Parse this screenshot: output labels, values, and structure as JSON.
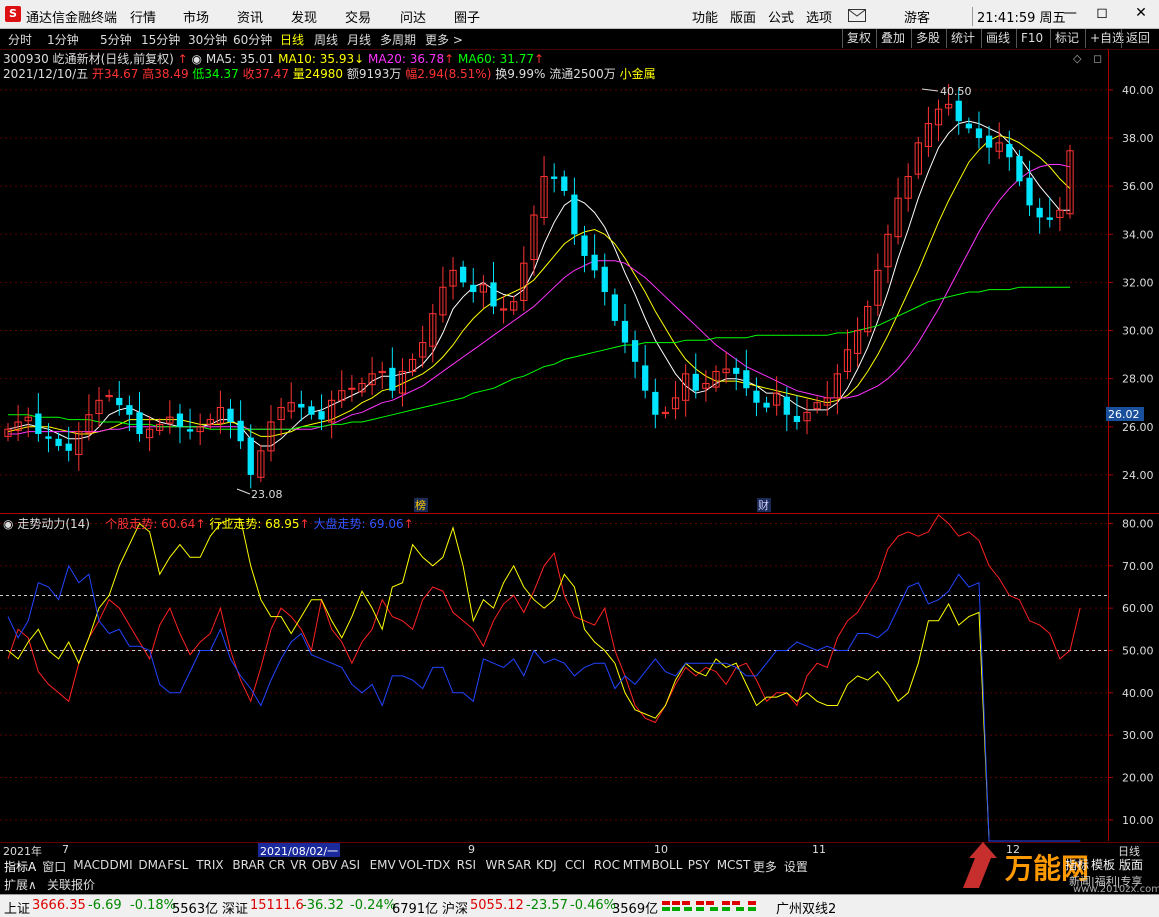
{
  "titlebar": {
    "logo_text": "S",
    "app_name": "通达信金融终端",
    "menus": [
      "行情",
      "市场",
      "资讯",
      "发现",
      "交易",
      "问达",
      "圈子"
    ],
    "right_menus": [
      "功能",
      "版面",
      "公式",
      "选项"
    ],
    "user": "游客",
    "clock": "21:41:59 周五",
    "email_icon": "envelope-icon"
  },
  "period_tabs": [
    "分时",
    "1分钟",
    "5分钟",
    "15分钟",
    "30分钟",
    "60分钟",
    "日线",
    "周线",
    "月线",
    "多周期",
    "更多 >"
  ],
  "active_period": "日线",
  "right_buttons": [
    "复权",
    "叠加",
    "多股",
    "统计",
    "画线",
    "F10",
    "标记",
    "+自选",
    "返回"
  ],
  "stock": {
    "title": "300930 屹通新材(日线,前复权)",
    "ma5": "MA5: 35.01",
    "ma10": "MA10: 35.93",
    "ma20": "MA20: 36.78",
    "ma60": "MA60: 31.77",
    "date": "2021/12/10/五",
    "open": "开34.67",
    "high": "高38.49",
    "low": "低34.37",
    "close": "收37.47",
    "volume": "量24980",
    "amount": "额9193万",
    "change": "幅2.94(8.51%)",
    "turnover": "换9.99%",
    "float": "流通2500万",
    "sector": "小金属",
    "max_label": "40.50",
    "min_label": "23.08",
    "current_price_tag": "26.02",
    "marker_bang": "榜",
    "marker_cai": "财",
    "colors": {
      "up": "#ff3333",
      "down": "#00e5ff",
      "ma5": "#ffffff",
      "ma10": "#ffff00",
      "ma20": "#ff33ff",
      "ma60": "#00ff00"
    }
  },
  "indicator": {
    "name": "走势动力(14)",
    "stock_trend": "个股走势: 60.64",
    "industry_trend": "行业走势: 68.95",
    "market_trend": "大盘走势: 69.06"
  },
  "chart_data": [
    {
      "type": "candlestick",
      "title": "300930 屹通新材(日线,前复权)",
      "y_ticks": [
        "40.00",
        "38.00",
        "36.00",
        "34.00",
        "32.00",
        "30.00",
        "28.00",
        "26.00",
        "24.00"
      ],
      "ylim": [
        22.5,
        41.7
      ],
      "series": [
        {
          "name": "K线",
          "close_path": [
            25.9,
            26.2,
            26.4,
            25.7,
            25.5,
            25.2,
            25.0,
            25.8,
            26.5,
            27.1,
            27.3,
            26.9,
            26.5,
            25.7,
            25.9,
            26.1,
            26.4,
            26.0,
            25.8,
            26.0,
            26.3,
            26.8,
            26.2,
            25.4,
            24.0,
            25.0,
            26.2,
            26.8,
            27.0,
            26.8,
            26.5,
            26.3,
            27.1,
            27.5,
            27.6,
            27.8,
            28.2,
            28.3,
            27.5,
            28.3,
            28.8,
            29.5,
            30.7,
            31.8,
            32.5,
            32.0,
            31.6,
            31.9,
            31.0,
            30.9,
            31.2,
            32.8,
            34.8,
            36.4,
            36.3,
            35.8,
            34.0,
            33.1,
            32.5,
            31.6,
            30.4,
            29.5,
            28.7,
            27.5,
            26.5,
            26.6,
            27.2,
            28.2,
            27.5,
            27.8,
            28.3,
            28.4,
            28.2,
            27.6,
            27.0,
            26.8,
            27.4,
            26.5,
            26.2,
            26.6,
            27.0,
            27.2,
            28.2,
            29.2,
            30.0,
            31.0,
            32.5,
            34.0,
            35.5,
            36.4,
            37.8,
            38.6,
            39.2,
            39.4,
            38.7,
            38.4,
            38.0,
            37.6,
            37.8,
            37.2,
            36.2,
            35.2,
            34.7,
            34.6,
            35.0,
            37.47
          ]
        },
        {
          "name": "MA5",
          "values": [
            25.9,
            26.0,
            26.1,
            26.0,
            25.9,
            25.7,
            25.5,
            25.5,
            25.6,
            26.0,
            26.5,
            26.7,
            26.8,
            26.6,
            26.4,
            26.2,
            26.1,
            26.0,
            26.0,
            26.0,
            26.1,
            26.3,
            26.3,
            26.0,
            25.5,
            25.2,
            25.2,
            25.5,
            25.9,
            26.3,
            26.6,
            26.7,
            26.9,
            27.1,
            27.3,
            27.5,
            27.9,
            28.1,
            28.1,
            28.2,
            28.3,
            28.6,
            29.1,
            29.9,
            30.9,
            31.4,
            31.8,
            32.0,
            31.7,
            31.5,
            31.4,
            31.7,
            32.5,
            33.6,
            34.5,
            35.2,
            35.5,
            35.3,
            34.9,
            34.3,
            33.4,
            32.4,
            31.5,
            30.5,
            29.6,
            28.9,
            28.2,
            27.7,
            27.4,
            27.5,
            27.8,
            28.0,
            28.0,
            27.9,
            27.7,
            27.4,
            27.4,
            27.2,
            26.9,
            26.7,
            26.7,
            26.7,
            27.0,
            27.6,
            28.4,
            29.3,
            30.4,
            31.6,
            33.0,
            34.2,
            35.5,
            36.6,
            37.6,
            38.2,
            38.6,
            38.7,
            38.6,
            38.4,
            38.2,
            37.8,
            37.2,
            36.6,
            36.0,
            35.5,
            35.0,
            35.0
          ]
        },
        {
          "name": "MA10",
          "values": [
            25.8,
            25.9,
            26.0,
            26.0,
            26.0,
            25.9,
            25.8,
            25.7,
            25.7,
            25.8,
            25.9,
            26.1,
            26.3,
            26.3,
            26.3,
            26.3,
            26.3,
            26.3,
            26.2,
            26.1,
            26.1,
            26.1,
            26.2,
            26.1,
            25.8,
            25.6,
            25.6,
            25.7,
            25.8,
            26.0,
            26.1,
            26.2,
            26.3,
            26.5,
            26.7,
            27.0,
            27.2,
            27.5,
            27.6,
            27.8,
            28.0,
            28.2,
            28.5,
            28.9,
            29.4,
            30.0,
            30.5,
            30.9,
            31.2,
            31.4,
            31.6,
            31.8,
            32.1,
            32.6,
            33.1,
            33.6,
            33.9,
            34.1,
            34.2,
            34.0,
            33.6,
            33.0,
            32.3,
            31.6,
            30.8,
            30.1,
            29.4,
            28.8,
            28.4,
            28.1,
            27.9,
            27.9,
            27.9,
            27.8,
            27.7,
            27.6,
            27.5,
            27.4,
            27.3,
            27.2,
            27.1,
            27.0,
            27.1,
            27.3,
            27.7,
            28.3,
            29.0,
            29.8,
            30.7,
            31.6,
            32.5,
            33.5,
            34.5,
            35.4,
            36.2,
            37.0,
            37.5,
            37.9,
            38.1,
            38.0,
            37.8,
            37.5,
            37.2,
            36.8,
            36.3,
            35.9
          ]
        },
        {
          "name": "MA20",
          "values": [
            25.7,
            25.7,
            25.8,
            25.8,
            25.8,
            25.8,
            25.8,
            25.8,
            25.8,
            25.8,
            25.9,
            25.9,
            26.0,
            26.0,
            26.0,
            26.0,
            26.0,
            26.0,
            26.0,
            26.0,
            26.0,
            26.0,
            26.0,
            26.0,
            25.9,
            25.9,
            25.9,
            25.9,
            25.9,
            25.9,
            25.9,
            26.0,
            26.1,
            26.3,
            26.5,
            26.6,
            26.8,
            27.0,
            27.1,
            27.3,
            27.5,
            27.7,
            28.0,
            28.3,
            28.6,
            28.9,
            29.2,
            29.5,
            29.8,
            30.1,
            30.4,
            30.7,
            31.0,
            31.4,
            31.8,
            32.2,
            32.5,
            32.7,
            32.9,
            32.9,
            32.9,
            32.8,
            32.5,
            32.2,
            31.8,
            31.4,
            31.0,
            30.6,
            30.2,
            29.8,
            29.4,
            29.1,
            28.8,
            28.5,
            28.3,
            28.1,
            27.9,
            27.7,
            27.5,
            27.4,
            27.3,
            27.2,
            27.2,
            27.2,
            27.3,
            27.5,
            27.7,
            28.0,
            28.4,
            28.9,
            29.5,
            30.2,
            30.9,
            31.7,
            32.5,
            33.3,
            34.1,
            34.8,
            35.4,
            35.9,
            36.3,
            36.6,
            36.8,
            36.9,
            36.9,
            36.8
          ]
        },
        {
          "name": "MA60",
          "values": [
            26.5,
            26.5,
            26.5,
            26.4,
            26.4,
            26.4,
            26.3,
            26.3,
            26.3,
            26.2,
            26.2,
            26.2,
            26.1,
            26.1,
            26.1,
            26.0,
            26.0,
            26.0,
            26.0,
            26.0,
            25.9,
            25.9,
            25.9,
            25.9,
            25.9,
            25.9,
            25.9,
            25.9,
            25.9,
            26.0,
            26.0,
            26.0,
            26.1,
            26.1,
            26.2,
            26.2,
            26.3,
            26.4,
            26.5,
            26.6,
            26.7,
            26.8,
            26.9,
            27.0,
            27.1,
            27.2,
            27.4,
            27.5,
            27.6,
            27.8,
            28.0,
            28.1,
            28.3,
            28.5,
            28.6,
            28.8,
            28.9,
            29.0,
            29.1,
            29.2,
            29.3,
            29.4,
            29.4,
            29.5,
            29.5,
            29.5,
            29.5,
            29.6,
            29.6,
            29.6,
            29.7,
            29.7,
            29.7,
            29.7,
            29.8,
            29.8,
            29.8,
            29.8,
            29.8,
            29.8,
            29.8,
            29.8,
            29.9,
            29.9,
            30.0,
            30.1,
            30.2,
            30.4,
            30.6,
            30.8,
            31.0,
            31.2,
            31.3,
            31.4,
            31.5,
            31.6,
            31.6,
            31.7,
            31.7,
            31.7,
            31.8,
            31.8,
            31.8,
            31.8,
            31.8,
            31.8
          ]
        }
      ]
    },
    {
      "type": "line",
      "title": "走势动力(14)",
      "y_ticks": [
        "80.00",
        "70.00",
        "60.00",
        "50.00",
        "40.00",
        "30.00",
        "20.00",
        "10.00"
      ],
      "ylim": [
        5,
        82
      ],
      "reference_lines": [
        63,
        50
      ],
      "series": [
        {
          "name": "个股走势",
          "values": [
            48,
            55,
            53,
            45,
            42,
            40,
            38,
            47,
            53,
            57,
            62,
            60,
            56,
            52,
            48,
            56,
            60,
            54,
            49,
            52,
            54,
            60,
            50,
            43,
            38,
            46,
            55,
            60,
            58,
            55,
            50,
            62,
            55,
            52,
            47,
            52,
            55,
            62,
            58,
            57,
            55,
            62,
            65,
            64,
            59,
            57,
            55,
            51,
            57,
            61,
            63,
            59,
            64,
            70,
            73,
            63,
            58,
            57,
            56,
            60,
            50,
            44,
            37,
            34,
            33,
            37,
            42,
            46,
            44,
            46,
            45,
            42,
            46,
            47,
            43,
            38,
            40,
            40,
            37,
            44,
            47,
            46,
            53,
            57,
            59,
            63,
            67,
            74,
            77,
            78,
            77,
            78,
            82,
            80,
            77,
            78,
            76,
            70,
            67,
            63,
            62,
            57,
            56,
            54,
            48,
            50,
            60
          ]
        },
        {
          "name": "行业走势",
          "values": [
            50,
            48,
            52,
            55,
            50,
            48,
            52,
            47,
            53,
            60,
            63,
            70,
            75,
            80,
            78,
            68,
            72,
            75,
            72,
            72,
            77,
            80,
            81,
            81,
            70,
            62,
            58,
            58,
            54,
            58,
            62,
            62,
            57,
            53,
            58,
            64,
            60,
            55,
            65,
            66,
            75,
            72,
            70,
            72,
            79,
            70,
            57,
            62,
            60,
            66,
            70,
            65,
            62,
            60,
            62,
            68,
            65,
            55,
            52,
            50,
            47,
            40,
            36,
            35,
            34,
            37,
            43,
            47,
            45,
            44,
            48,
            46,
            47,
            42,
            37,
            39,
            39,
            40,
            38,
            40,
            38,
            37,
            37,
            42,
            44,
            43,
            45,
            42,
            38,
            40,
            47,
            57,
            57,
            61,
            56,
            58,
            59,
            5,
            5,
            5,
            5,
            5,
            5,
            5,
            5,
            5,
            5
          ]
        },
        {
          "name": "大盘走势",
          "values": [
            58,
            53,
            57,
            66,
            65,
            62,
            70,
            66,
            68,
            57,
            54,
            55,
            51,
            51,
            50,
            42,
            40,
            40,
            45,
            50,
            50,
            55,
            48,
            44,
            41,
            37,
            43,
            48,
            52,
            54,
            49,
            48,
            47,
            46,
            42,
            40,
            42,
            37,
            44,
            44,
            43,
            41,
            46,
            46,
            40,
            40,
            38,
            48,
            47,
            46,
            48,
            44,
            50,
            47,
            48,
            47,
            44,
            46,
            47,
            47,
            41,
            44,
            42,
            45,
            48,
            45,
            44,
            47,
            47,
            47,
            47,
            47,
            46,
            44,
            44,
            47,
            50,
            50,
            52,
            51,
            50,
            51,
            50,
            50,
            54,
            54,
            53,
            55,
            60,
            65,
            66,
            61,
            62,
            64,
            68,
            65,
            66,
            5,
            5,
            5,
            5,
            5,
            5,
            5,
            5,
            5,
            5
          ]
        }
      ]
    }
  ],
  "date_bar": {
    "year_label": "2021年",
    "month_labels": [
      "7",
      "9",
      "10",
      "11",
      "12"
    ],
    "highlight_date": "2021/08/02/一",
    "right_label": "日线"
  },
  "indicator_tabs": [
    "指标A",
    "窗口",
    "MACD",
    "DMI",
    "DMA",
    "FSL",
    "TRIX",
    "BRAR",
    "CR",
    "VR",
    "OBV",
    "ASI",
    "EMV",
    "VOL-TDX",
    "RSI",
    "WR",
    "SAR",
    "KDJ",
    "CCI",
    "ROC",
    "MTM",
    "BOLL",
    "PSY",
    "MCST",
    "更多",
    "设置"
  ],
  "row3": [
    "扩展∧",
    "关联报价"
  ],
  "watermark": {
    "brand": "万能网",
    "site": "www.2010zx.com",
    "tag": "新闻|福利|专享"
  },
  "right_side_tabs": [
    "指标",
    "模板",
    "版面"
  ],
  "status_bar": [
    {
      "name": "上证",
      "value": "3666.35",
      "chg": "-6.69",
      "pct": "-0.18%",
      "amt": "5563亿"
    },
    {
      "name": "深证",
      "value": "15111.6",
      "chg": "-36.32",
      "pct": "-0.24%",
      "amt": "6791亿"
    },
    {
      "name": "沪深",
      "value": "5055.12",
      "chg": "-23.57",
      "pct": "-0.46%",
      "amt": "3569亿"
    }
  ],
  "status_right": "广州双线2"
}
